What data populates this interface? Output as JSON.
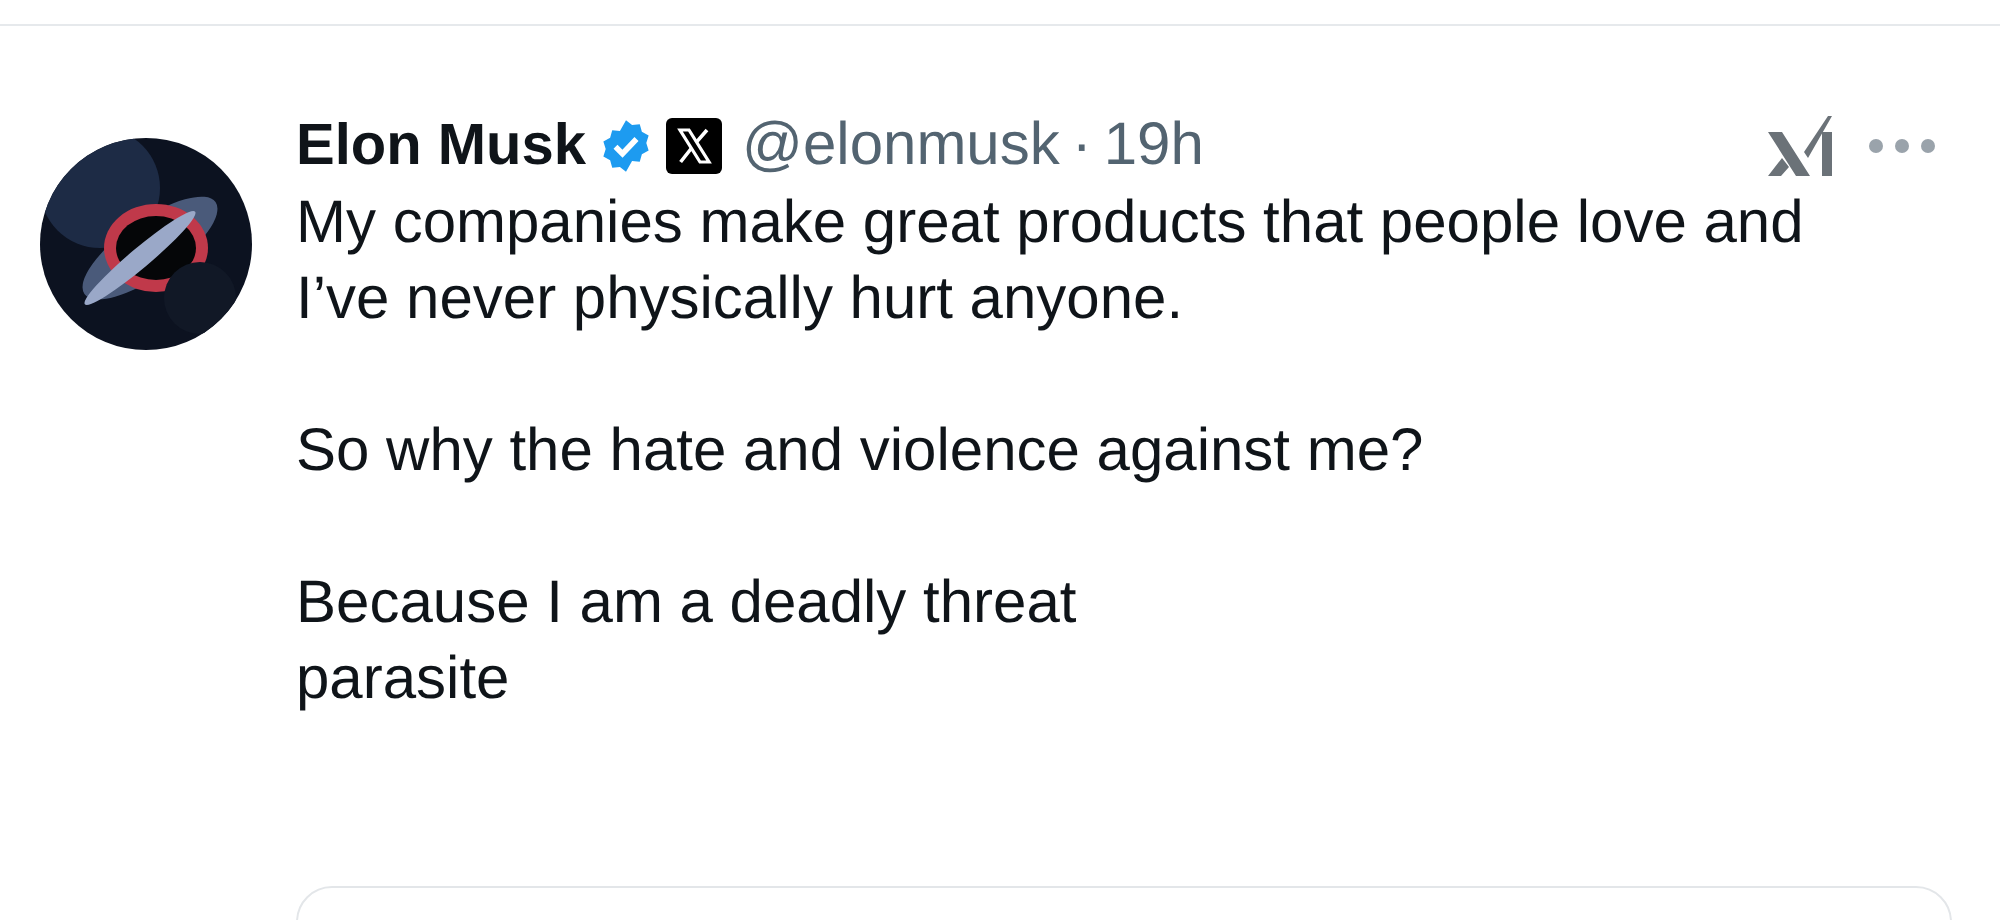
{
  "post": {
    "author": {
      "name": "Elon Musk",
      "verified": true,
      "handle": "@elonmusk",
      "separator": "·",
      "time": "19h"
    },
    "paragraphs": [
      [
        "My companies make great products that people love and I’ve never physically hurt anyone."
      ],
      [
        "So why the hate and violence against me?"
      ],
      [
        "Because I am a deadly threat",
        "parasite"
      ]
    ]
  }
}
